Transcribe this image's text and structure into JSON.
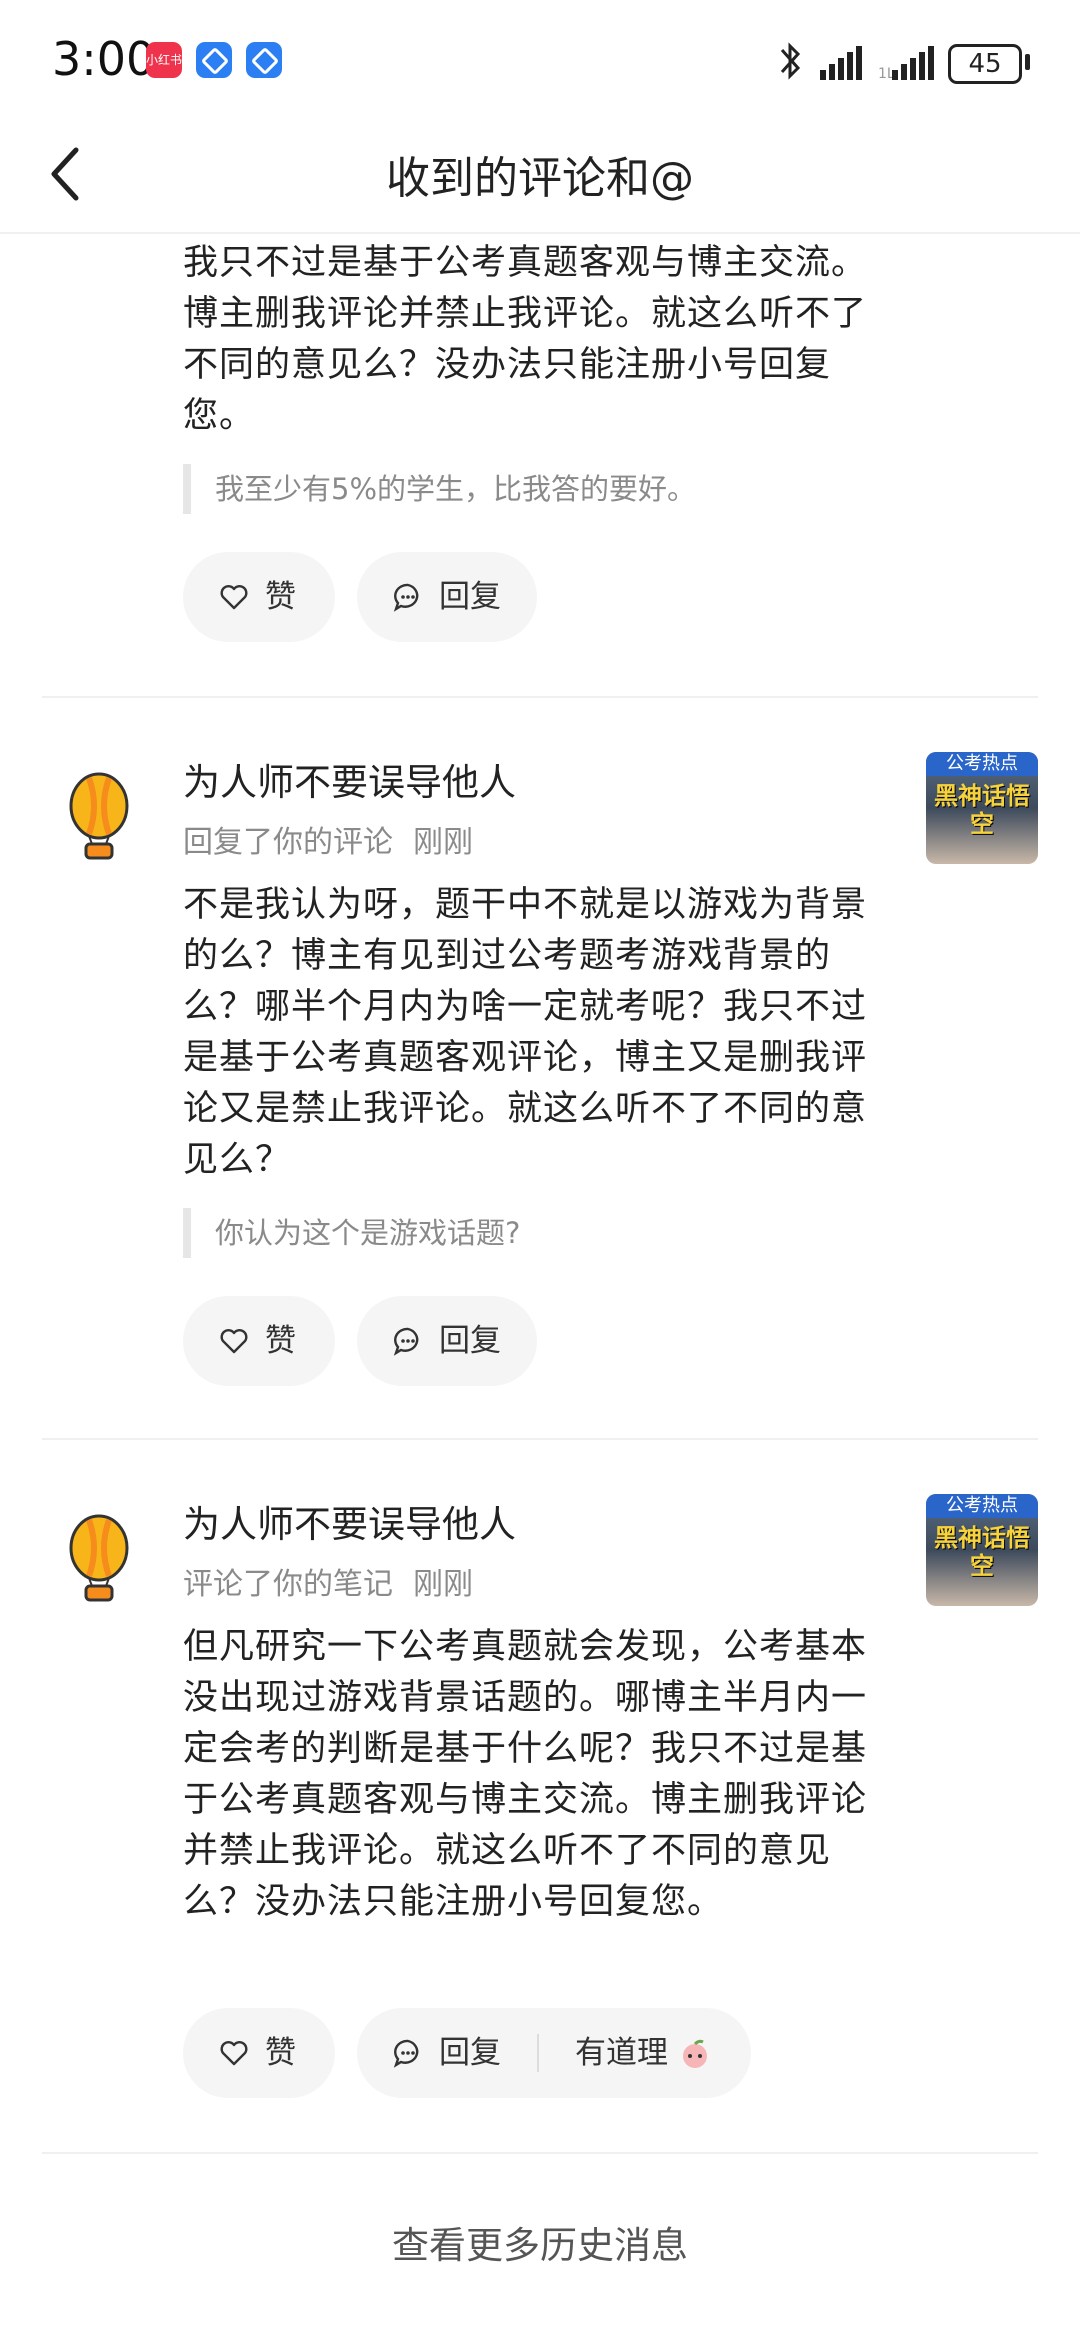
{
  "status_bar": {
    "time": "3:00",
    "battery": "45",
    "icons": [
      "xiaohongshu-app-icon",
      "blue-app-icon",
      "blue-app-icon",
      "bluetooth-icon",
      "signal-icon",
      "signal-icon",
      "battery-icon"
    ]
  },
  "header": {
    "title": "收到的评论和@",
    "back_icon": "chevron-left-icon"
  },
  "comments": [
    {
      "text": "我只不过是基于公考真题客观与博主交流。博主删我评论并禁止我评论。就这么听不了不同的意见么？没办法只能注册小号回复您。",
      "quote": "我至少有5%的学生，比我答的要好。",
      "like_label": "赞",
      "reply_label": "回复"
    },
    {
      "username": "为人师不要误导他人",
      "action": "回复了你的评论",
      "time": "刚刚",
      "thumb_top": "公考热点",
      "thumb_text": "黑神话悟空",
      "text": "不是我认为呀，题干中不就是以游戏为背景的么？博主有见到过公考题考游戏背景的么？哪半个月内为啥一定就考呢？我只不过是基于公考真题客观评论，博主又是删我评论又是禁止我评论。就这么听不了不同的意见么？",
      "quote": "你认为这个是游戏话题?",
      "like_label": "赞",
      "reply_label": "回复"
    },
    {
      "username": "为人师不要误导他人",
      "action": "评论了你的笔记",
      "time": "刚刚",
      "thumb_top": "公考热点",
      "thumb_text": "黑神话悟空",
      "text": "但凡研究一下公考真题就会发现，公考基本没出现过游戏背景话题的。哪博主半月内一定会考的判断是基于什么呢？我只不过是基于公考真题客观与博主交流。博主删我评论并禁止我评论。就这么听不了不同的意见么？没办法只能注册小号回复您。",
      "like_label": "赞",
      "reply_label": "回复",
      "quick_reply": "有道理"
    }
  ],
  "footer": {
    "more_history": "查看更多历史消息"
  },
  "colors": {
    "pill_bg": "#f5f5f5",
    "secondary_text": "#8a8a8a",
    "avatar_balloon": "#f7b519"
  }
}
